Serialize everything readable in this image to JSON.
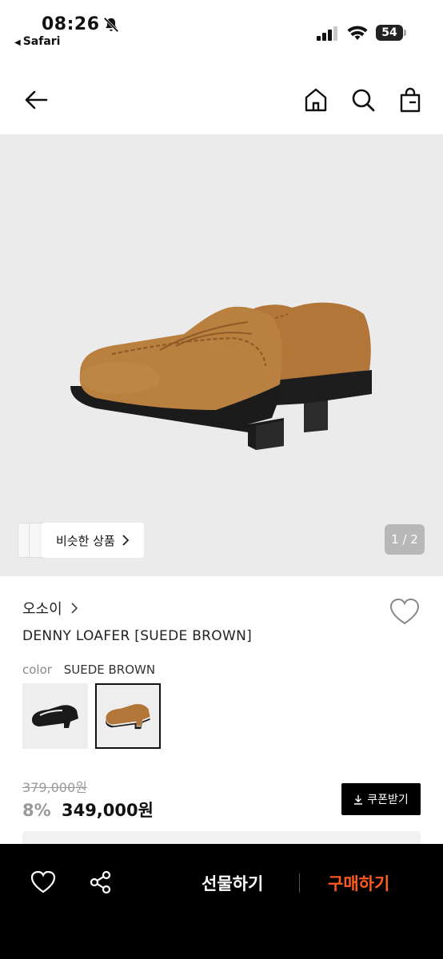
{
  "status_bar": {
    "time": "08:26",
    "back_app": "Safari",
    "battery": "54"
  },
  "gallery": {
    "similar_label": "비슷한 상품",
    "counter": "1 / 2"
  },
  "product": {
    "brand": "오소이",
    "name": "DENNY LOAFER [SUEDE BROWN]",
    "color_label": "color",
    "color_value": "SUEDE BROWN",
    "original_price": "379,000원",
    "discount": "8%",
    "price": "349,000원",
    "coupon_label": "쿠폰받기",
    "swatches": [
      {
        "name": "BLACK",
        "selected": false
      },
      {
        "name": "SUEDE BROWN",
        "selected": true
      }
    ]
  },
  "bottom_bar": {
    "gift_label": "선물하기",
    "buy_label": "구매하기",
    "buy_color": "#ff5a1f"
  },
  "colors": {
    "suede": "#b57c3f",
    "gallery_bg": "#ebebeb"
  }
}
